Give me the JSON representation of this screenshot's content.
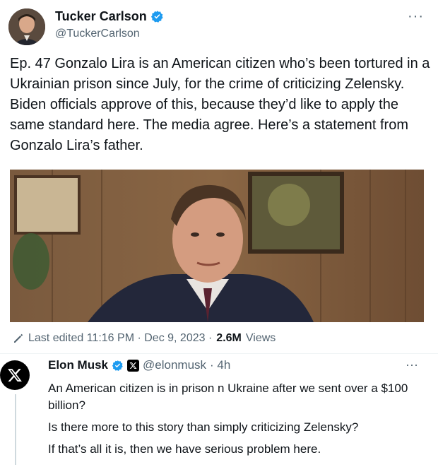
{
  "tweet": {
    "author_name": "Tucker Carlson",
    "author_handle": "@TuckerCarlson",
    "more_label": "···",
    "text": "Ep. 47  Gonzalo Lira is an American citizen who’s been tortured in a Ukrainian prison since July, for the crime of criticizing Zelensky. Biden officials approve of this, because they’d like to apply the same standard here. The media agree. Here’s a statement from Gonzalo Lira’s father.",
    "meta": {
      "edited_label": "Last edited 11:16 PM · Dec 9, 2023 · ",
      "views_count": "2.6M",
      "views_label": "Views"
    }
  },
  "reply": {
    "author_name": "Elon Musk",
    "author_handle": "@elonmusk",
    "time": "· 4h",
    "more_label": "···",
    "avatar_glyph": "X",
    "lines": [
      "An American citizen is in prison n Ukraine after we sent over a $100 billion?",
      "Is there more to this story than simply criticizing Zelensky?",
      "If that’s all it is, then we have serious problem here."
    ]
  },
  "colors": {
    "verified_blue": "#1d9bf0",
    "secondary_text": "#536471"
  },
  "icons": {
    "verified": "verified-badge-icon",
    "edit": "pencil-icon",
    "x_logo": "x-logo-icon"
  }
}
